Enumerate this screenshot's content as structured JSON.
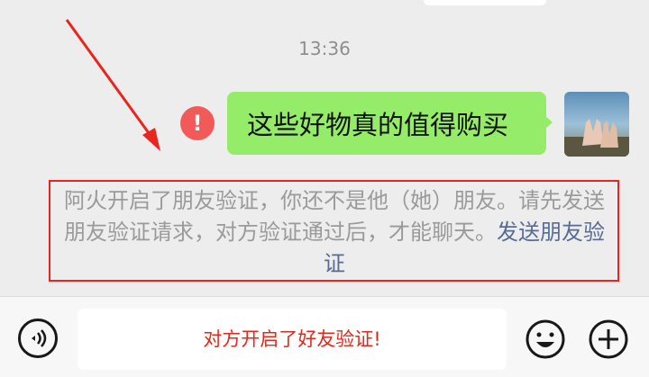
{
  "chat": {
    "timestamp": "13:36",
    "message": "这些好物真的值得购买",
    "error_mark": "!",
    "notice": {
      "text": "阿火开启了朋友验证，你还不是他（她）朋友。请先发送朋友验证请求，对方验证通过后，才能聊天。",
      "link": "发送朋友验证"
    }
  },
  "input_bar": {
    "text": "对方开启了好友验证!",
    "voice_icon": "voice-icon",
    "emoji_icon": "emoji-icon",
    "plus_icon": "plus-icon"
  },
  "colors": {
    "bubble": "#95ec69",
    "error": "#f25a5a",
    "link": "#576b95",
    "highlight": "#e8251f"
  }
}
